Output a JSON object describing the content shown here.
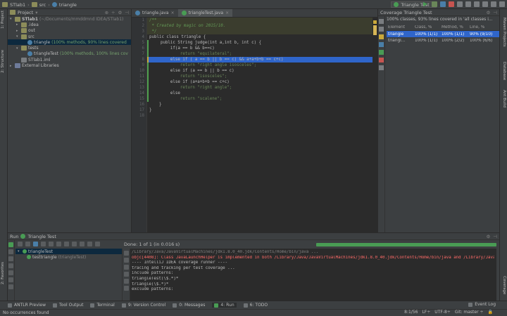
{
  "navbar": {
    "crumbs": [
      "STlab1",
      "src",
      "triangle"
    ],
    "run_config": "Triangle Test"
  },
  "left_stripe": {
    "tabs": [
      "1: Project",
      "2: Structure",
      "2: Favorites"
    ]
  },
  "right_stripe": {
    "tabs": [
      "Maven Projects",
      "Database",
      "Ant Build",
      "Coverage"
    ]
  },
  "project": {
    "title": "Project",
    "tree": [
      {
        "indent": 0,
        "icon": "module",
        "label": "STlab1",
        "extra": "(~/Documents/mmddmnd IDEA/STlab1)",
        "open": true
      },
      {
        "indent": 1,
        "icon": "folder",
        "label": ".idea",
        "extra": "",
        "open": false
      },
      {
        "indent": 1,
        "icon": "folder",
        "label": "out",
        "extra": "",
        "open": false
      },
      {
        "indent": 1,
        "icon": "folder",
        "label": "src",
        "extra": "",
        "open": true
      },
      {
        "indent": 2,
        "icon": "class",
        "label": "triangle",
        "extra": "(100% methods, 90% lines covered",
        "open": null,
        "selected": true
      },
      {
        "indent": 1,
        "icon": "folder",
        "label": "tests",
        "extra": "",
        "open": true
      },
      {
        "indent": 2,
        "icon": "class",
        "label": "triangleTest",
        "extra": "(100% methods, 100% lines cov",
        "open": null
      },
      {
        "indent": 1,
        "icon": "file",
        "label": "STlab1.iml",
        "extra": "",
        "open": null
      },
      {
        "indent": 0,
        "icon": "lib",
        "label": "External Libraries",
        "extra": "",
        "open": false
      }
    ]
  },
  "editor": {
    "tabs": [
      {
        "label": "triangle.java",
        "active": false
      },
      {
        "label": "triangleTest.java",
        "active": true
      }
    ],
    "line_numbers": [
      "1",
      "2",
      "3",
      "4",
      "5",
      "6",
      "7",
      "8",
      "9",
      "10",
      "11",
      "12",
      "13",
      "14",
      "15",
      "16",
      "17",
      "18"
    ],
    "lines": [
      "/**",
      " * Created by magic on 2015/10.",
      " */",
      "public class triangle {",
      "    public String judge(int a,int b, int c) {",
      "        if(a == b && b==c)",
      "            return \"equilateral\";",
      "        else if ( a == b || b == c) && a+a+b+b == c+c)",
      "            return \"right angle isosceles\";",
      "        else if (a == b || b == c)",
      "            return \"isosceles\";",
      "        else if (a+a+b+b == c+c)",
      "            return \"right angle\";",
      "        else",
      "            return \"scalene\";",
      "    }",
      "}",
      ""
    ]
  },
  "coverage": {
    "title": "Coverage Triangle Test",
    "summary": "100% classes, 93% lines covered in 'all classes i...",
    "headers": [
      "Element",
      "Class, %",
      "Method, %",
      "Line, %"
    ],
    "rows": [
      {
        "element": "triangle",
        "class": "100% (1/1)",
        "method": "100% (1/1)",
        "line": "90% (9/10)",
        "selected": true
      },
      {
        "element": "triangl...",
        "class": "100% (1/1)",
        "method": "100% (2/2)",
        "line": "100% (6/6)",
        "selected": false
      }
    ]
  },
  "run": {
    "title": "Run",
    "config": "Triangle Test",
    "status": "Done: 1 of 1 (in 0.016 s)",
    "tree": [
      {
        "label": "triangleTest",
        "time": ""
      },
      {
        "label": "testtriangle",
        "time": "(triangleTest)"
      }
    ],
    "console": [
      {
        "text": "/Library/Java/JavaVirtualMachines/jdk1.8.0_40.jdk/Contents/Home/bin/java ...",
        "kind": "dim"
      },
      {
        "text": "objc[4408]: Class JavaLaunchHelper is implemented in both /Library/Java/JavaVirtualMachines/jdk1.8.0_40.jdk/Contents/Home/bin/java and /Library/Java",
        "kind": "err"
      },
      {
        "text": "---- IntelliJ IDEA coverage runner ----",
        "kind": "normal"
      },
      {
        "text": "tracing and tracking per test coverage ...",
        "kind": "normal"
      },
      {
        "text": "include patterns:",
        "kind": "normal"
      },
      {
        "text": "triangleTest(\\$.*)*",
        "kind": "normal"
      },
      {
        "text": "triangle(\\$.*)*",
        "kind": "normal"
      },
      {
        "text": "exclude patterns:",
        "kind": "normal"
      }
    ]
  },
  "bottom_tabs": [
    {
      "label": "ANTLR Preview",
      "active": false
    },
    {
      "label": "Tool Output",
      "active": false
    },
    {
      "label": "Terminal",
      "active": false
    },
    {
      "label": "9: Version Control",
      "active": false
    },
    {
      "label": "0: Messages",
      "active": false
    },
    {
      "label": "4: Run",
      "active": true
    },
    {
      "label": "6: TODO",
      "active": false
    }
  ],
  "event_log": "Event Log",
  "status": {
    "message": "No occurrences found",
    "position": "8:1/56",
    "line_sep": "LF÷",
    "encoding": "UTF-8÷",
    "vcs": "Git: master ÷"
  },
  "colors": {
    "bg": "#2b2b2b",
    "panel": "#3c3f41",
    "selection": "#2f65ca",
    "progress": "#499c54",
    "error": "#ff6b68"
  }
}
